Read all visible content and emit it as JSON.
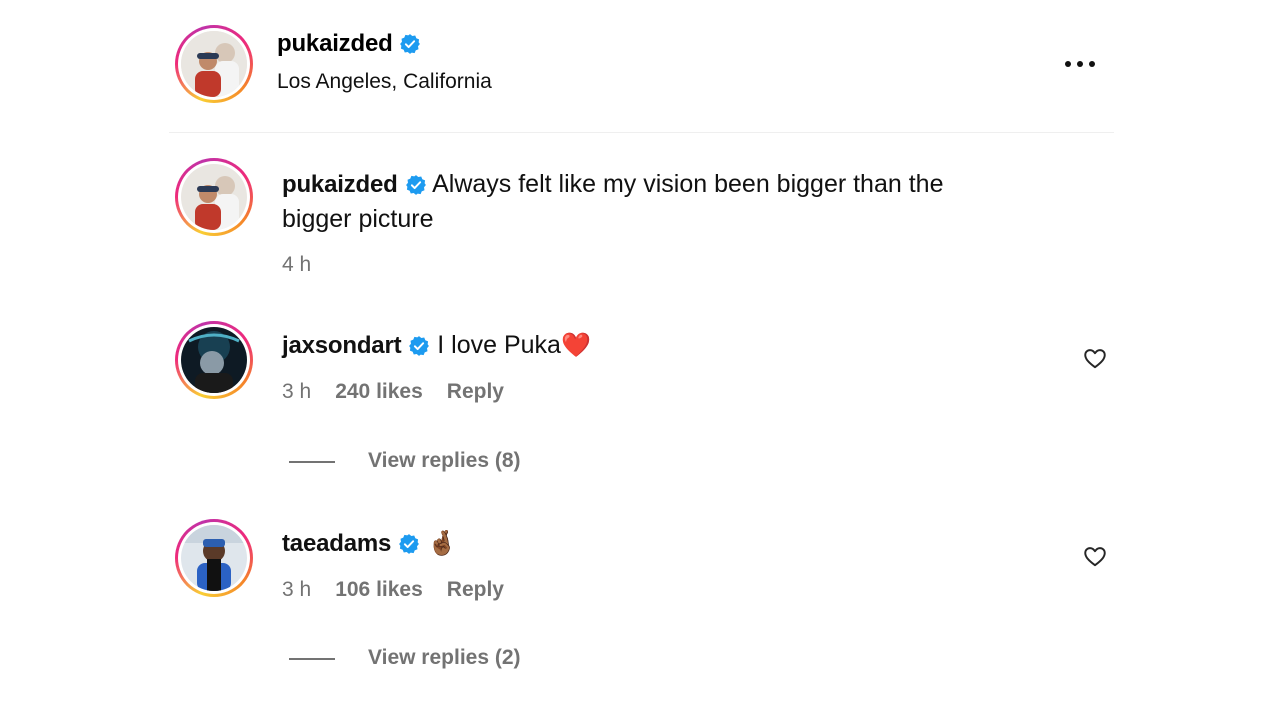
{
  "header": {
    "username": "pukaizded",
    "location": "Los Angeles, California",
    "more_icon": "more-horizontal-icon"
  },
  "caption": {
    "username": "pukaizded",
    "text_line1": "Always felt like my vision been bigger than the",
    "text_line2": "bigger picture",
    "time": "4 h"
  },
  "comments": [
    {
      "username": "jaxsondart",
      "text": "I love Puka",
      "emoji": "❤️",
      "time": "3 h",
      "likes": "240 likes",
      "reply_label": "Reply",
      "view_replies": "View replies (8)"
    },
    {
      "username": "taeadams",
      "text": "",
      "emoji": "🤞🏾",
      "time": "3 h",
      "likes": "106 likes",
      "reply_label": "Reply",
      "view_replies": "View replies (2)"
    }
  ],
  "colors": {
    "verified": "#1d9bf0",
    "meta": "#737373",
    "divider": "#efefef"
  }
}
